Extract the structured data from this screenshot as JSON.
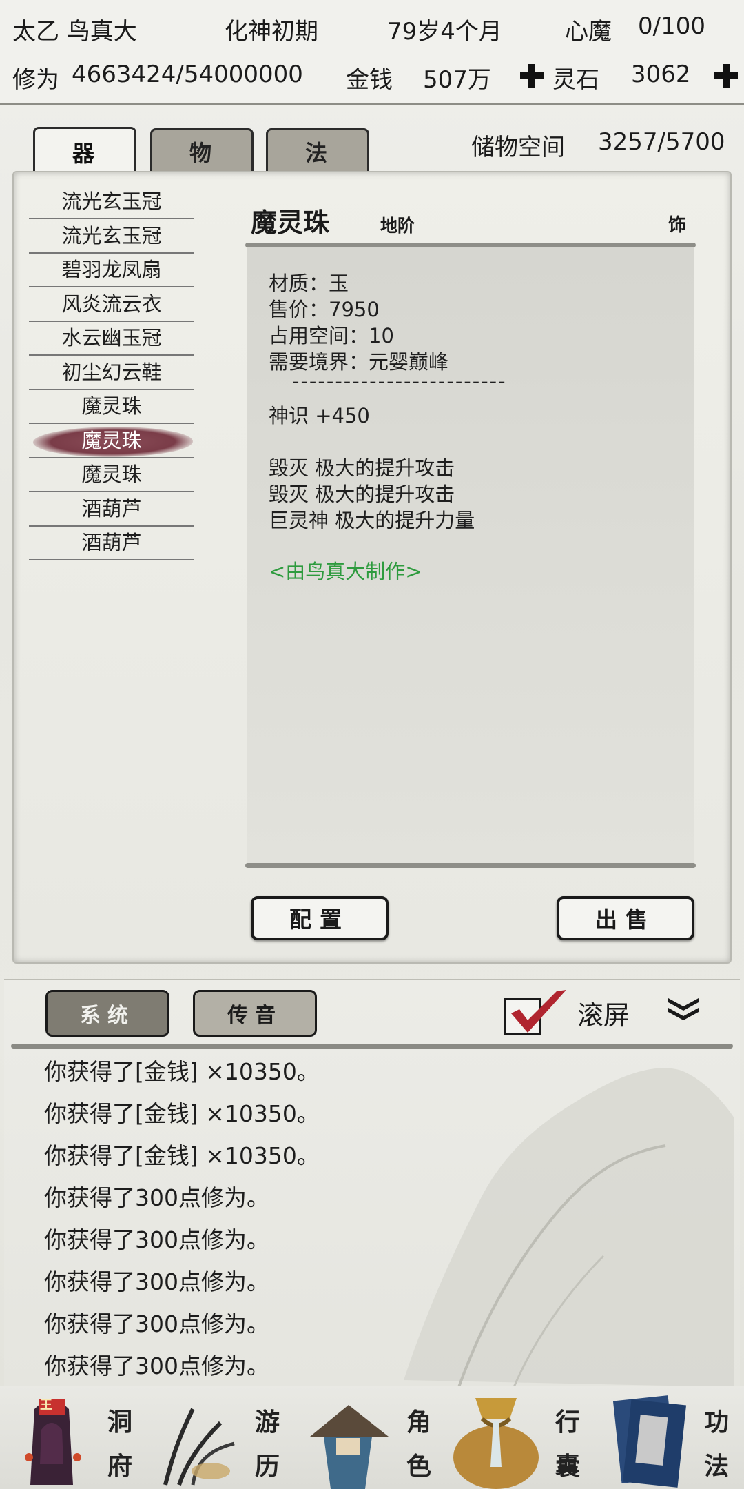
{
  "header": {
    "name": "太乙 鸟真大",
    "realm": "化神初期",
    "age": "79岁4个月",
    "inner_demon_label": "心魔",
    "inner_demon_value": "0/100",
    "cultivation_label": "修为",
    "cultivation_value": "4663424/54000000",
    "money_label": "金钱",
    "money_value": "507万",
    "spirit_stone_label": "灵石",
    "spirit_stone_value": "3062"
  },
  "tabs": [
    {
      "label": "器"
    },
    {
      "label": "物"
    },
    {
      "label": "法"
    }
  ],
  "storage": {
    "label": "储物空间",
    "value": "3257/5700"
  },
  "item_list": [
    "流光玄玉冠",
    "流光玄玉冠",
    "碧羽龙凤扇",
    "风炎流云衣",
    "水云幽玉冠",
    "初尘幻云鞋",
    "魔灵珠",
    "魔灵珠",
    "魔灵珠",
    "酒葫芦",
    "酒葫芦"
  ],
  "detail": {
    "name": "魔灵珠",
    "grade": "地阶",
    "type": "饰",
    "lines": [
      "材质：玉",
      "售价：7950",
      "占用空间：10",
      "需要境界：元婴巅峰"
    ],
    "divider": "-------------------------",
    "bonus": "神识 +450",
    "effects": [
      "毁灭 极大的提升攻击",
      "毁灭 极大的提升攻击",
      "巨灵神 极大的提升力量"
    ],
    "maker": "<由鸟真大制作>",
    "maker_color": "#2e9b3e"
  },
  "buttons": {
    "equip": "配置",
    "sell": "出售"
  },
  "log": {
    "tab_system": "系统",
    "tab_message": "传音",
    "scroll_label": "滚屏",
    "lines": [
      "你获得了[金钱] ×10350。",
      "你获得了[金钱] ×10350。",
      "你获得了[金钱] ×10350。",
      "你获得了300点修为。",
      "你获得了300点修为。",
      "你获得了300点修为。",
      "你获得了300点修为。",
      "你获得了300点修为。"
    ]
  },
  "nav": [
    {
      "top": "洞",
      "bottom": "府"
    },
    {
      "top": "游",
      "bottom": "历"
    },
    {
      "top": "角",
      "bottom": "色"
    },
    {
      "top": "行",
      "bottom": "囊"
    },
    {
      "top": "功",
      "bottom": "法"
    }
  ],
  "nav_badge": "王"
}
